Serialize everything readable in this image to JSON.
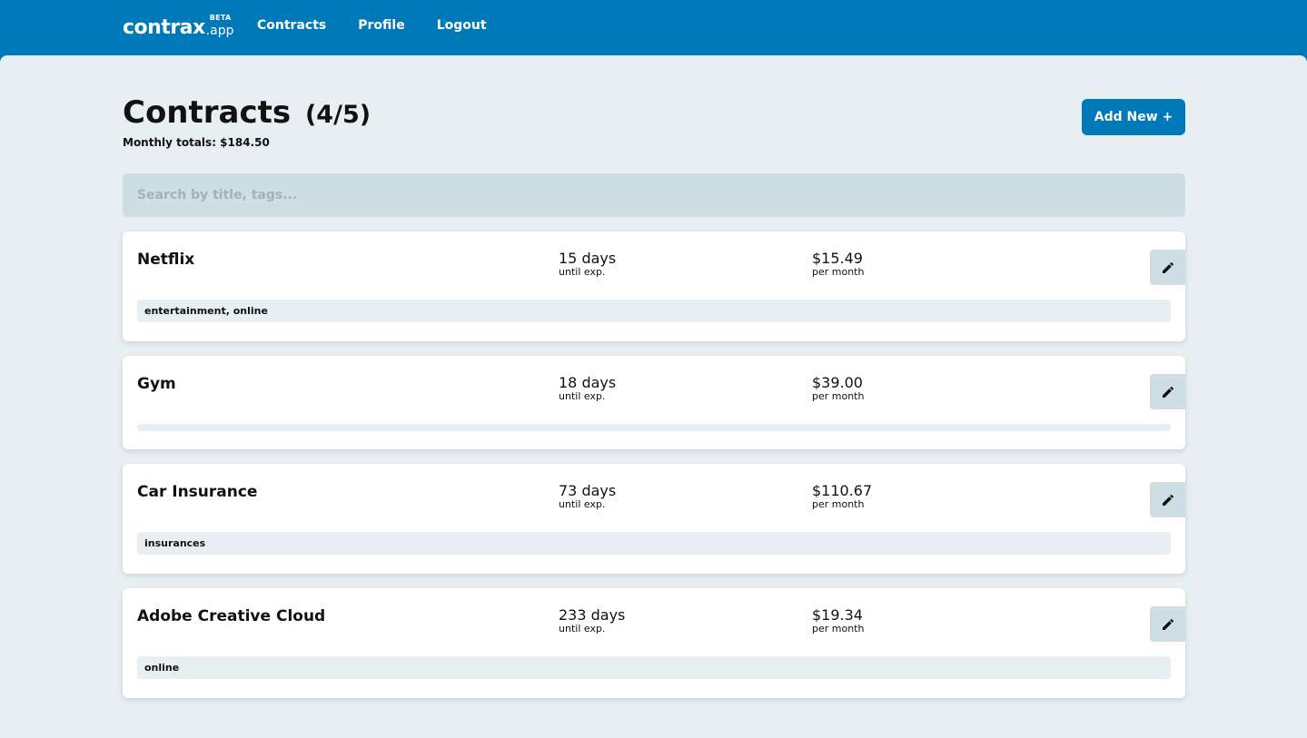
{
  "app": {
    "logo_text": "contrax",
    "logo_suffix": ".app",
    "logo_badge": "BETA"
  },
  "nav": {
    "items": [
      {
        "label": "Contracts"
      },
      {
        "label": "Profile"
      },
      {
        "label": "Logout"
      }
    ]
  },
  "page": {
    "title": "Contracts",
    "count": "(4/5)",
    "totals": "Monthly totals: $184.50",
    "add_button": "Add New +"
  },
  "search": {
    "placeholder": "Search by title, tags...",
    "value": ""
  },
  "contracts": [
    {
      "title": "Netflix",
      "days": "15 days",
      "days_caption": "until exp.",
      "price": "$15.49",
      "price_caption": "per month",
      "tags": "entertainment, online"
    },
    {
      "title": "Gym",
      "days": "18 days",
      "days_caption": "until exp.",
      "price": "$39.00",
      "price_caption": "per month",
      "tags": ""
    },
    {
      "title": "Car Insurance",
      "days": "73 days",
      "days_caption": "until exp.",
      "price": "$110.67",
      "price_caption": "per month",
      "tags": "insurances"
    },
    {
      "title": "Adobe Creative Cloud",
      "days": "233 days",
      "days_caption": "until exp.",
      "price": "$19.34",
      "price_caption": "per month",
      "tags": "online"
    }
  ],
  "icons": {
    "edit": "pencil-icon"
  },
  "colors": {
    "brand": "#0079b9",
    "background": "#e7eff3",
    "search_bg": "#cfdde4"
  }
}
